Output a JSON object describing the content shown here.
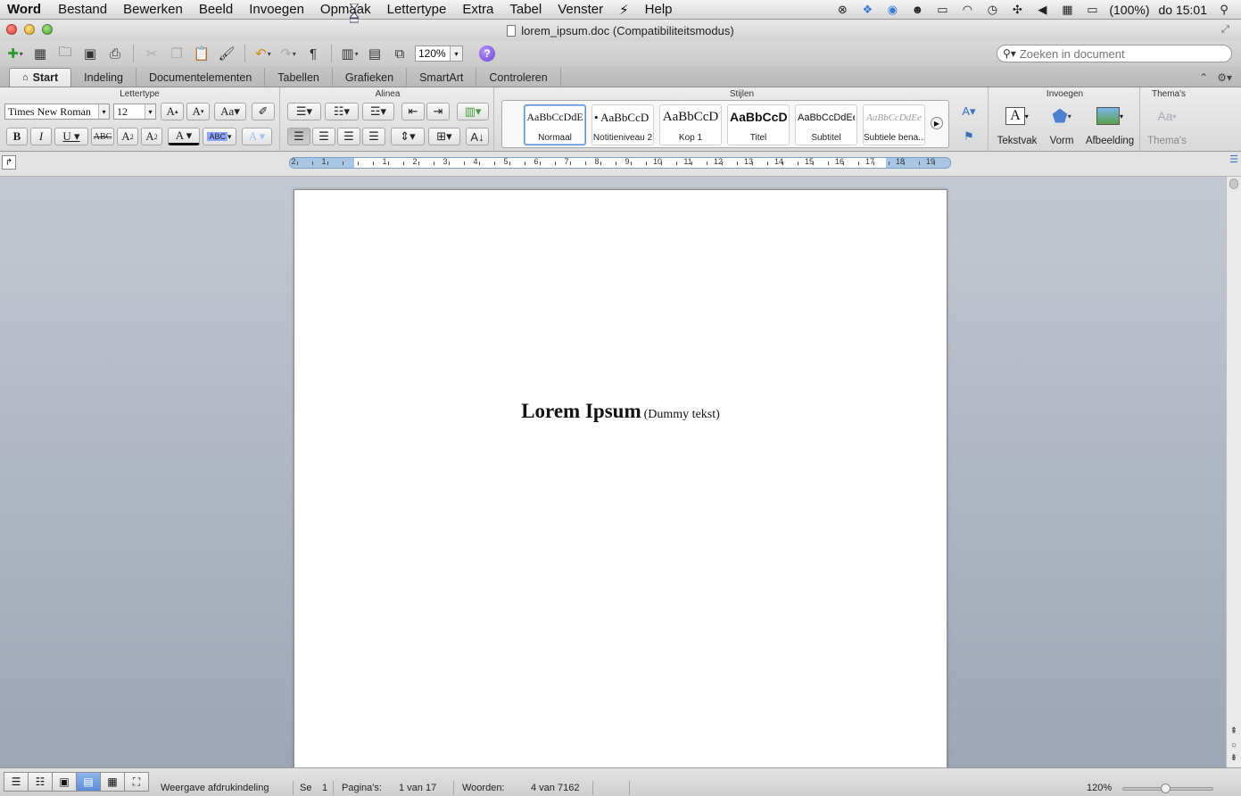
{
  "menubar": {
    "app": "Word",
    "items": [
      "Bestand",
      "Bewerken",
      "Beeld",
      "Invoegen",
      "Opmaak",
      "Lettertype",
      "Extra",
      "Tabel",
      "Venster",
      "Help"
    ],
    "battery": "(100%)",
    "clock": "do 15:01"
  },
  "window": {
    "title": "lorem_ipsum.doc (Compatibiliteitsmodus)"
  },
  "toolbar": {
    "zoom": "120%",
    "search_placeholder": "Zoeken in document"
  },
  "ribbon_tabs": [
    "Start",
    "Indeling",
    "Documentelementen",
    "Tabellen",
    "Grafieken",
    "SmartArt",
    "Controleren"
  ],
  "ribbon": {
    "font_group_title": "Lettertype",
    "paragraph_group_title": "Alinea",
    "styles_group_title": "Stijlen",
    "insert_group_title": "Invoegen",
    "themes_group_title": "Thema's",
    "font_name": "Times New Roman",
    "font_size": "12",
    "styles": [
      {
        "sample": "AaBbCcDdE",
        "name": "Normaal"
      },
      {
        "sample": "• AaBbCcD",
        "name": "Notitieniveau 2"
      },
      {
        "sample": "AaBbCcD",
        "name": "Kop 1"
      },
      {
        "sample": "AaBbCcDc",
        "name": "Titel"
      },
      {
        "sample": "AaBbCcDdEe",
        "name": "Subtitel"
      },
      {
        "sample": "AaBbCcDdEe",
        "name": "Subtiele bena..."
      }
    ],
    "insert_buttons": [
      "Tekstvak",
      "Vorm",
      "Afbeelding"
    ],
    "themes_button": "Thema's"
  },
  "ruler": {
    "left_numbers": [
      "2",
      "1"
    ],
    "numbers": [
      "1",
      "2",
      "3",
      "4",
      "5",
      "6",
      "7",
      "8",
      "9",
      "10",
      "11",
      "12",
      "13",
      "14",
      "15",
      "16",
      "17",
      "18",
      "19"
    ]
  },
  "document": {
    "heading": "Lorem Ipsum",
    "subheading": "(Dummy tekst)"
  },
  "statusbar": {
    "view": "Weergave afdrukindeling",
    "section_label": "Se",
    "section_value": "1",
    "pages_label": "Pagina's:",
    "pages_value": "1 van 17",
    "words_label": "Woorden:",
    "words_value": "4 van 7162",
    "zoom": "120%",
    "zoom_level_percent": 47
  }
}
